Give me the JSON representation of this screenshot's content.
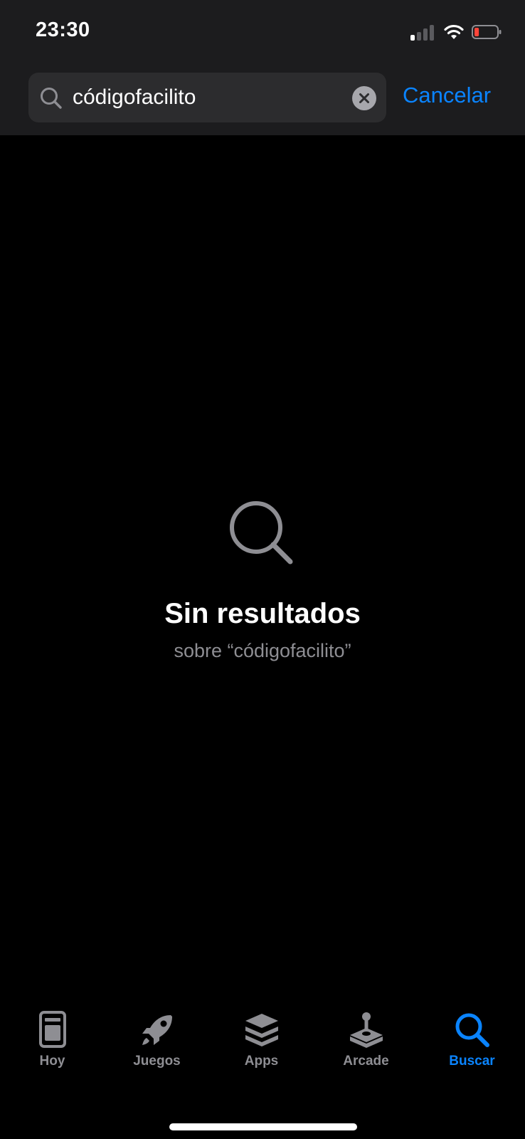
{
  "status_bar": {
    "time": "23:30",
    "signal_bars_active": 1,
    "signal_bars_total": 4,
    "battery_level": 0.12,
    "battery_color": "#ff453a"
  },
  "search": {
    "value": "códigofacilito",
    "cancel_label": "Cancelar",
    "accent_color": "#0a84ff"
  },
  "empty_state": {
    "icon": "magnifying-glass-icon",
    "title": "Sin resultados",
    "subtitle": "sobre “códigofacilito”"
  },
  "tab_bar": {
    "tabs": [
      {
        "label": "Hoy",
        "icon": "today-card-icon",
        "active": false
      },
      {
        "label": "Juegos",
        "icon": "rocket-icon",
        "active": false
      },
      {
        "label": "Apps",
        "icon": "stack-layers-icon",
        "active": false
      },
      {
        "label": "Arcade",
        "icon": "joystick-icon",
        "active": false
      },
      {
        "label": "Buscar",
        "icon": "search-icon",
        "active": true
      }
    ]
  }
}
